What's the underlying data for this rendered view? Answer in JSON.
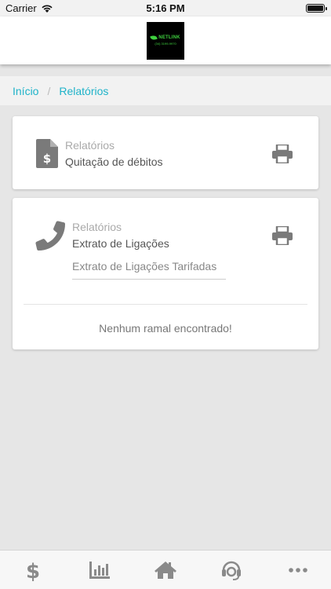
{
  "status_bar": {
    "carrier": "Carrier",
    "time": "5:16 PM"
  },
  "header": {
    "logo_text": "NETLINK",
    "logo_phone": "(34) 3199-9970"
  },
  "breadcrumb": {
    "home": "Início",
    "separator": "/",
    "current": "Relatórios"
  },
  "cards": [
    {
      "category": "Relatórios",
      "title": "Quitação de débitos",
      "icon": "file-dollar-icon"
    },
    {
      "category": "Relatórios",
      "title": "Extrato de Ligações",
      "subfield": "Extrato de Ligações Tarifadas",
      "empty_message": "Nenhum ramal encontrado!",
      "icon": "phone-icon"
    }
  ],
  "tabs": [
    {
      "icon": "dollar-icon"
    },
    {
      "icon": "bar-chart-icon"
    },
    {
      "icon": "home-icon"
    },
    {
      "icon": "support-headset-icon"
    },
    {
      "icon": "more-icon"
    }
  ],
  "colors": {
    "accent": "#1fb3c9",
    "icon_gray": "#7a7a7a",
    "tab_icon": "#8a8a8a",
    "logo_green": "#3fd13f"
  }
}
